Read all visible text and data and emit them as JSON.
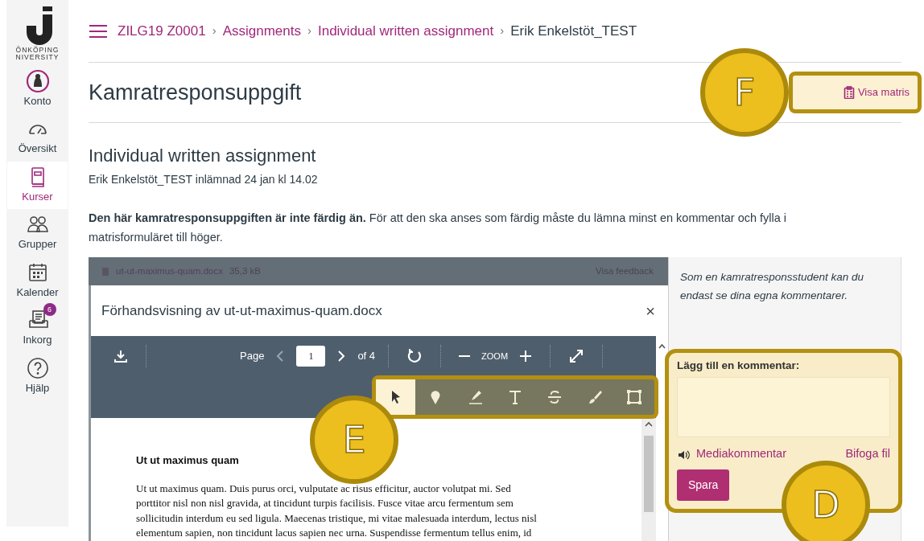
{
  "sidebar": {
    "logo": {
      "lines": [
        "ÖNKÖPING",
        "NIVERSITY"
      ]
    },
    "items": [
      {
        "label": "Konto",
        "kind": "avatar",
        "selected": false
      },
      {
        "label": "Översikt",
        "kind": "dashboard",
        "selected": false
      },
      {
        "label": "Kurser",
        "kind": "book",
        "selected": true
      },
      {
        "label": "Grupper",
        "kind": "people",
        "selected": false
      },
      {
        "label": "Kalender",
        "kind": "calendar",
        "selected": false
      },
      {
        "label": "Inkorg",
        "kind": "inbox",
        "selected": false,
        "badge": "6"
      },
      {
        "label": "Hjälp",
        "kind": "help",
        "selected": false
      }
    ]
  },
  "breadcrumb": [
    {
      "label": "ZILG19 Z0001"
    },
    {
      "separator": "›",
      "label": "Assignments"
    },
    {
      "separator": "›",
      "label": "Individual written assignment"
    },
    {
      "separator": "›",
      "label": "Erik Enkelstöt_TEST"
    }
  ],
  "page_title": "Kamratresponsuppgift",
  "rubric_button": {
    "label": "Visa matris",
    "highlighted": true,
    "callout": "F"
  },
  "assignment": {
    "title": "Individual written assignment",
    "submitted": "Erik Enkelstöt_TEST inlämnad 24 jan kl 14.02"
  },
  "notice": "**Den här kamratresponsuppgiften är inte färdig än.** För att den ska anses som färdig måste du lämna minst en kommentar och fylla i matrisformuläret till höger.",
  "file_bar": {
    "filename": "ut-ut-maximus-quam.docx",
    "size": "35,3 kB",
    "link": "Visa feedback"
  },
  "preview": {
    "title": "Förhandsvisning av ut-ut-maximus-quam.docx",
    "close": "×",
    "toolbar": {
      "page_label": "Page",
      "page": "1",
      "of": "of 4",
      "zoom": "ZOOM"
    },
    "tools_highlighted": true,
    "tools_callout": "E",
    "tools": [
      {
        "kind": "select",
        "selected": true
      },
      {
        "kind": "pin",
        "selected": false
      },
      {
        "kind": "highlight",
        "selected": false
      },
      {
        "kind": "text",
        "selected": false
      },
      {
        "kind": "strike",
        "selected": false
      },
      {
        "kind": "brush",
        "selected": false
      },
      {
        "kind": "area",
        "selected": false
      }
    ],
    "document": {
      "heading": "Ut ut maximus quam",
      "lines": [
        "Ut ut maximus quam. Duis purus orci, vulputate ac risus efficitur, auctor volutpat mi. Sed",
        "porttitor nisl non nisl gravida, at tincidunt turpis facilisis. Fusce vitae arcu fermentum sem",
        "sollicitudin interdum eu sed ligula. Maecenas tristique, mi vitae malesuada interdum, lectus nisl",
        "elementum sapien, non tincidunt lacus sapien nec urna. Suspendisse fermentum tellus enim, id"
      ]
    }
  },
  "comment_panel": {
    "note": "Som en kamratresponsstudent kan du endast se dina egna kommentarer.",
    "highlighted": true,
    "callout": "D",
    "label": "Lägg till en kommentar:",
    "media_link": "Mediakommentar",
    "attach_link": "Bifoga fil",
    "save": "Spara"
  }
}
